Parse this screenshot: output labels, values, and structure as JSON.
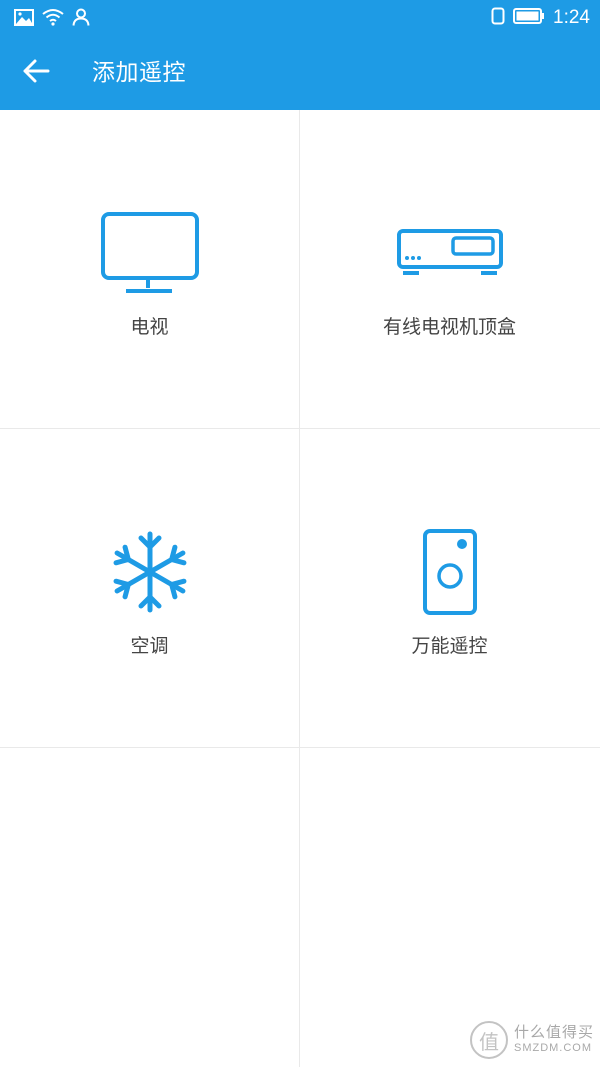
{
  "status_bar": {
    "time": "1:24",
    "icons": [
      "image-icon",
      "wifi-icon",
      "user-icon",
      "sim-icon",
      "battery-icon"
    ]
  },
  "app_bar": {
    "title": "添加遥控",
    "back_icon": "arrow-left-icon"
  },
  "devices": [
    {
      "label": "电视",
      "icon": "tv-icon"
    },
    {
      "label": "有线电视机顶盒",
      "icon": "set-top-box-icon"
    },
    {
      "label": "空调",
      "icon": "snowflake-icon"
    },
    {
      "label": "万能遥控",
      "icon": "universal-remote-icon"
    }
  ],
  "watermark": {
    "logo_char": "值",
    "text_cn": "什么值得买",
    "text_en": "SMZDM.COM"
  },
  "colors": {
    "primary": "#1e9be5",
    "icon": "#1e9be5",
    "label": "#444444",
    "divider": "#e9e9e9"
  }
}
